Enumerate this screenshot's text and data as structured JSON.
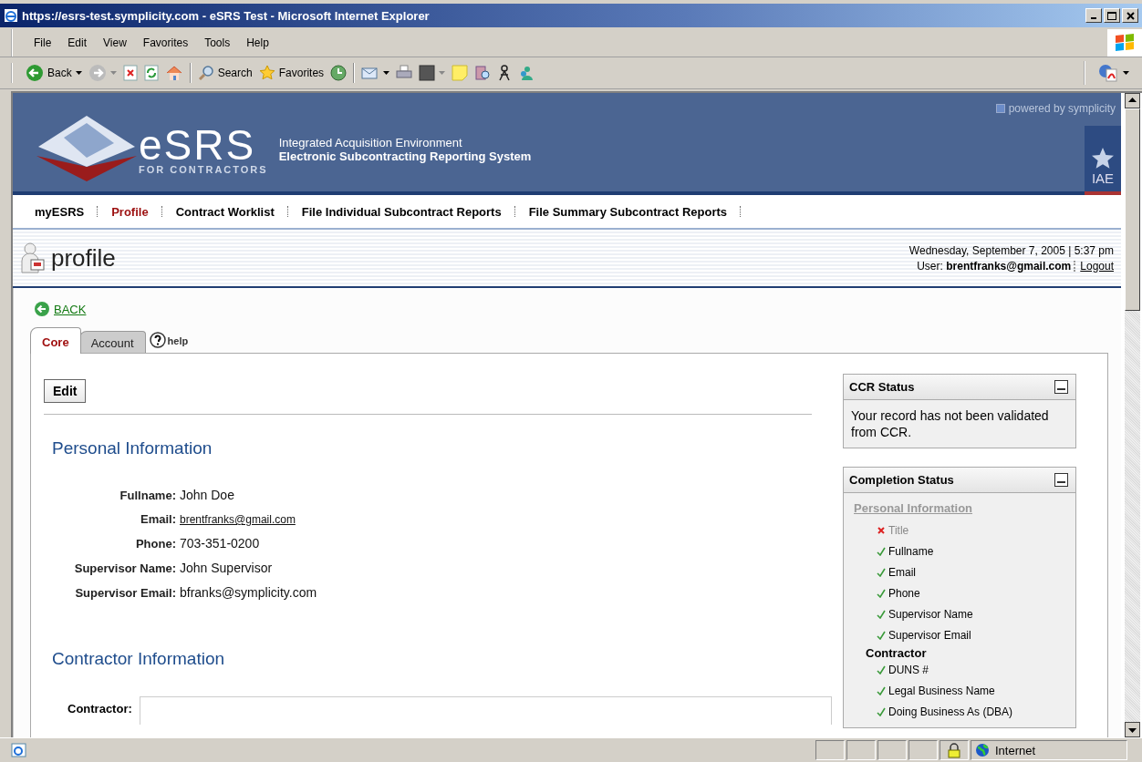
{
  "window": {
    "title": "https://esrs-test.symplicity.com - eSRS Test - Microsoft Internet Explorer"
  },
  "menu": [
    "File",
    "Edit",
    "View",
    "Favorites",
    "Tools",
    "Help"
  ],
  "toolbar": [
    {
      "kind": "back",
      "label": "Back"
    },
    {
      "kind": "search",
      "label": "Search"
    },
    {
      "kind": "favorites",
      "label": "Favorites"
    }
  ],
  "banner": {
    "powered_by": "powered by symplicity",
    "logo": "eSRS",
    "logo_sub": "FOR CONTRACTORS",
    "line1": "Integrated Acquisition Environment",
    "line2": "Electronic Subcontracting Reporting System",
    "badge": "IAE"
  },
  "nav": [
    {
      "label": "myESRS",
      "selected": false
    },
    {
      "label": "Profile",
      "selected": true
    },
    {
      "label": "Contract Worklist",
      "selected": false
    },
    {
      "label": "File Individual Subcontract Reports",
      "selected": false
    },
    {
      "label": "File Summary Subcontract Reports",
      "selected": false
    }
  ],
  "page": {
    "title": "profile",
    "datetime": "Wednesday, September 7, 2005 | 5:37 pm",
    "user_label": "User:",
    "user": "brentfranks@gmail.com",
    "logout": "Logout"
  },
  "back_link": "BACK",
  "tabs": [
    {
      "label": "Core",
      "selected": true
    },
    {
      "label": "Account",
      "selected": false
    }
  ],
  "help": "help",
  "edit_button": "Edit",
  "personal": {
    "heading": "Personal Information",
    "fields": [
      {
        "label": "Fullname:",
        "value": "John Doe",
        "link": false
      },
      {
        "label": "Email:",
        "value": "brentfranks@gmail.com",
        "link": true
      },
      {
        "label": "Phone:",
        "value": "703-351-0200",
        "link": false
      },
      {
        "label": "Supervisor Name:",
        "value": "John Supervisor",
        "link": false
      },
      {
        "label": "Supervisor Email:",
        "value": "bfranks@symplicity.com",
        "link": false
      }
    ]
  },
  "contractor": {
    "heading": "Contractor Information",
    "label": "Contractor:"
  },
  "ccr_status": {
    "title": "CCR Status",
    "text": "Your record has not been validated from CCR."
  },
  "completion_status": {
    "title": "Completion Status",
    "groups": [
      {
        "heading": "Personal Information",
        "kind": "link",
        "items": [
          {
            "label": "Title",
            "done": false
          },
          {
            "label": "Fullname",
            "done": true
          },
          {
            "label": "Email",
            "done": true
          },
          {
            "label": "Phone",
            "done": true
          },
          {
            "label": "Supervisor Name",
            "done": true
          },
          {
            "label": "Supervisor Email",
            "done": true
          }
        ]
      },
      {
        "heading": "Contractor",
        "kind": "label",
        "items": [
          {
            "label": "DUNS #",
            "done": true
          },
          {
            "label": "Legal Business Name",
            "done": true
          },
          {
            "label": "Doing Business As (DBA)",
            "done": true
          }
        ]
      }
    ]
  },
  "status_bar": {
    "zone": "Internet"
  }
}
